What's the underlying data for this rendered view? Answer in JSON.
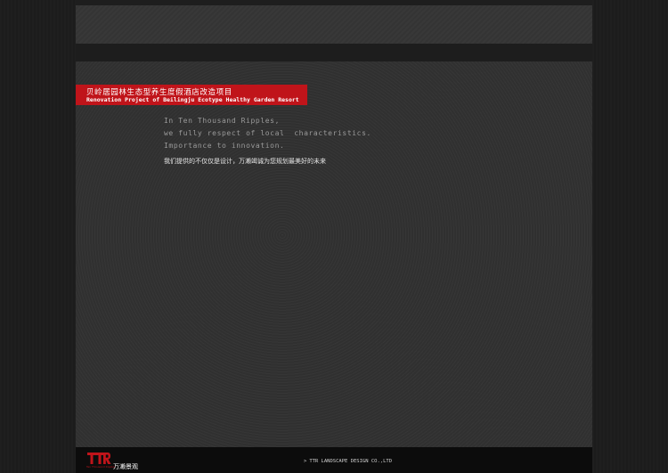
{
  "title": {
    "cn": "贝岭居园林生态型养生度假酒店改造项目",
    "en": "Renovation Project of Beilingju Ecotype Healthy Garden Resort"
  },
  "slogan": {
    "lines": [
      "In Ten Thousand Ripples,",
      "we fully respect of local  characteristics.",
      "Importance to innovation."
    ],
    "cn": "我们提供的不仅仅是设计，万濑竭诚为您规划最美好的未来"
  },
  "footer": {
    "logo_text": "TTR",
    "logo_sub": "Ten Thousand Ripples",
    "logo_cn": "万濑景观",
    "company_arrow": ">",
    "company": "TTR LANDSCAPE DESIGN CO.,LTD"
  },
  "colors": {
    "accent": "#c0141a",
    "background": "#1e1e1e",
    "panel": "#333333"
  }
}
